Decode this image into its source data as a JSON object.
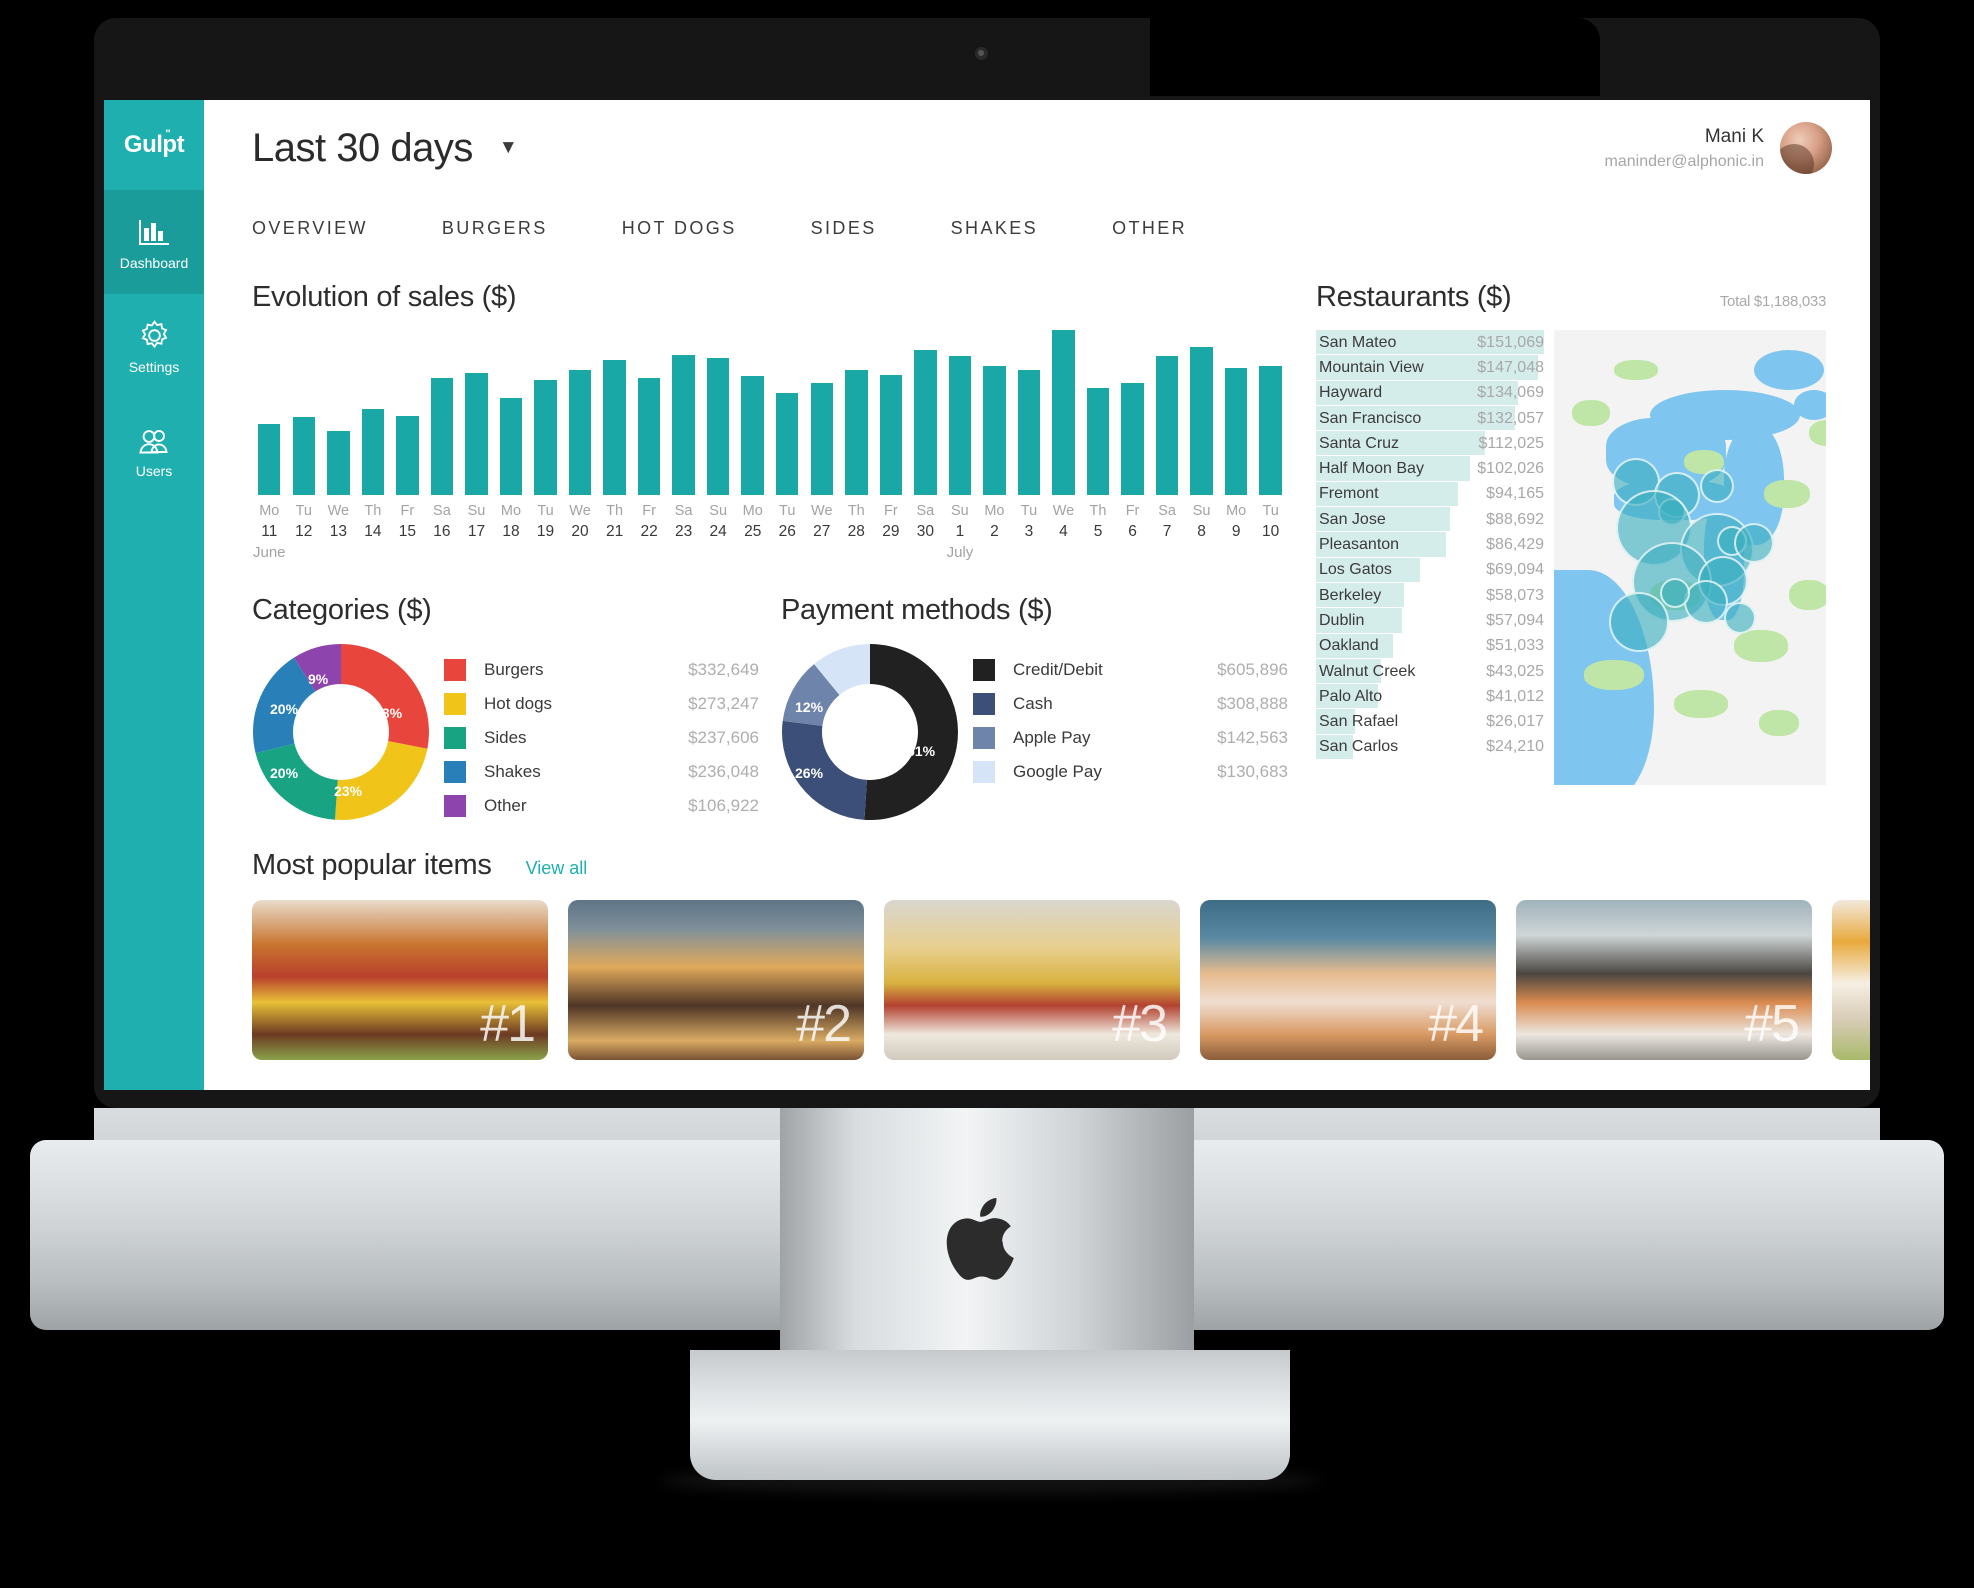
{
  "brand": {
    "name": "Gulp",
    "suffix": "t",
    "dot": "\""
  },
  "sidebar": {
    "items": [
      {
        "label": "Dashboard",
        "icon": "bar-chart-icon",
        "active": true
      },
      {
        "label": "Settings",
        "icon": "gear-icon",
        "active": false
      },
      {
        "label": "Users",
        "icon": "users-icon",
        "active": false
      }
    ]
  },
  "topbar": {
    "range_label": "Last 30 days",
    "caret": "▼",
    "user_name": "Mani K",
    "user_email": "maninder@alphonic.in"
  },
  "tabs": [
    {
      "label": "OVERVIEW"
    },
    {
      "label": "BURGERS"
    },
    {
      "label": "HOT DOGS"
    },
    {
      "label": "SIDES"
    },
    {
      "label": "SHAKES"
    },
    {
      "label": "OTHER"
    }
  ],
  "sections": {
    "evolution_title": "Evolution of sales ($)",
    "categories_title": "Categories ($)",
    "payments_title": "Payment methods ($)",
    "restaurants_title": "Restaurants ($)",
    "restaurants_total": "Total $1,188,033",
    "popular_title": "Most popular items",
    "view_all": "View all"
  },
  "colors": {
    "teal": "#1eafae",
    "teal_bar": "#1aa8a6",
    "rest_bar": "#d4ecea",
    "burgers": "#e8453c",
    "hotdogs": "#f0c419",
    "sides": "#18a383",
    "shakes": "#2980b9",
    "other": "#8e44ad",
    "credit": "#212121",
    "cash": "#3b4f78",
    "applepay": "#6f84ab",
    "googlepay": "#d6e4f7"
  },
  "chart_data": [
    {
      "type": "bar",
      "title": "Evolution of sales ($)",
      "xlabel": "",
      "ylabel": "",
      "grid": false,
      "categories": [
        "11",
        "12",
        "13",
        "14",
        "15",
        "16",
        "17",
        "18",
        "19",
        "20",
        "21",
        "22",
        "23",
        "24",
        "25",
        "26",
        "27",
        "28",
        "29",
        "30",
        "1",
        "2",
        "3",
        "4",
        "5",
        "6",
        "7",
        "8",
        "9",
        "10"
      ],
      "dow": [
        "Mo",
        "Tu",
        "We",
        "Th",
        "Fr",
        "Sa",
        "Su",
        "Mo",
        "Tu",
        "We",
        "Th",
        "Fr",
        "Sa",
        "Su",
        "Mo",
        "Tu",
        "We",
        "Th",
        "Fr",
        "Sa",
        "Su",
        "Mo",
        "Tu",
        "We",
        "Th",
        "Fr",
        "Sa",
        "Su",
        "Mo",
        "Tu"
      ],
      "months": [
        "June",
        "July"
      ],
      "values": [
        43,
        47,
        39,
        52,
        48,
        71,
        74,
        59,
        70,
        76,
        82,
        71,
        85,
        83,
        72,
        62,
        68,
        76,
        73,
        88,
        84,
        78,
        76,
        100,
        65,
        68,
        84,
        90,
        77,
        78
      ]
    },
    {
      "type": "pie",
      "title": "Categories ($)",
      "legend": "right",
      "labels": [
        "Burgers",
        "Hot dogs",
        "Sides",
        "Shakes",
        "Other"
      ],
      "values": [
        332649,
        273247,
        237606,
        236048,
        106922
      ],
      "value_labels": [
        "$332,649",
        "$273,247",
        "$237,606",
        "$236,048",
        "$106,922"
      ],
      "percent_labels": [
        "20%",
        "20%",
        "9%",
        "23%",
        "28%"
      ],
      "colors": [
        "#e8453c",
        "#f0c419",
        "#18a383",
        "#2980b9",
        "#8e44ad"
      ]
    },
    {
      "type": "pie",
      "title": "Payment methods ($)",
      "legend": "right",
      "labels": [
        "Credit/Debit",
        "Cash",
        "Apple Pay",
        "Google Pay"
      ],
      "values": [
        605896,
        308888,
        142563,
        130683
      ],
      "value_labels": [
        "$605,896",
        "$308,888",
        "$142,563",
        "$130,683"
      ],
      "percent_labels": [
        "12%",
        "26%",
        "51%"
      ],
      "colors": [
        "#212121",
        "#3b4f78",
        "#6f84ab",
        "#d6e4f7"
      ]
    },
    {
      "type": "bar",
      "title": "Restaurants ($)",
      "orientation": "horizontal",
      "categories": [
        "San Mateo",
        "Mountain View",
        "Hayward",
        "San Francisco",
        "Santa Cruz",
        "Half Moon Bay",
        "Fremont",
        "San Jose",
        "Pleasanton",
        "Los Gatos",
        "Berkeley",
        "Dublin",
        "Oakland",
        "Walnut Creek",
        "Palo Alto",
        "San Rafael",
        "San Carlos"
      ],
      "values": [
        151069,
        147048,
        134069,
        132057,
        112025,
        102026,
        94165,
        88692,
        86429,
        69094,
        58073,
        57094,
        51033,
        43025,
        41012,
        26017,
        24210
      ],
      "value_labels": [
        "$151,069",
        "$147,048",
        "$134,069",
        "$132,057",
        "$112,025",
        "$102,026",
        "$94,165",
        "$88,692",
        "$86,429",
        "$69,094",
        "$58,073",
        "$57,094",
        "$51,033",
        "$43,025",
        "$41,012",
        "$26,017",
        "$24,210"
      ]
    }
  ],
  "popular_items": [
    {
      "rank": "#1",
      "kind": "cheeseburger"
    },
    {
      "rank": "#2",
      "kind": "sliders"
    },
    {
      "rank": "#3",
      "kind": "hotdogs"
    },
    {
      "rank": "#4",
      "kind": "shakes"
    },
    {
      "rank": "#5",
      "kind": "black-bun-burger"
    },
    {
      "rank": "",
      "kind": "fries"
    }
  ]
}
